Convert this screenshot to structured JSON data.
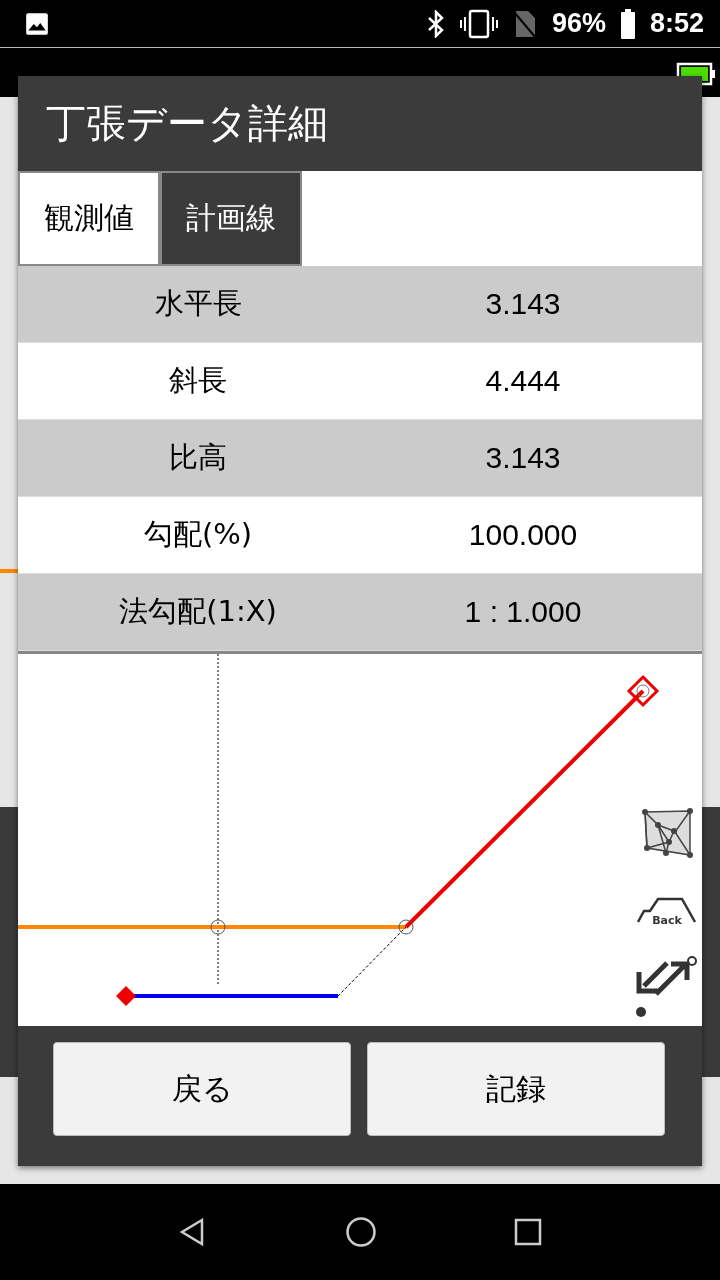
{
  "status_bar": {
    "battery_percent": "96%",
    "time": "8:52"
  },
  "dialog": {
    "title": "丁張データ詳細",
    "tabs": [
      {
        "label": "観測値",
        "selected": false
      },
      {
        "label": "計画線",
        "selected": true
      }
    ],
    "rows": [
      {
        "label": "水平長",
        "value": "3.143"
      },
      {
        "label": "斜長",
        "value": "4.444"
      },
      {
        "label": "比高",
        "value": "3.143"
      },
      {
        "label": "勾配(%)",
        "value": "100.000"
      },
      {
        "label": "法勾配(1:X)",
        "value": "1 : 1.000"
      }
    ],
    "back_icon_label": "Back",
    "buttons": [
      "戻る",
      "記録"
    ]
  }
}
